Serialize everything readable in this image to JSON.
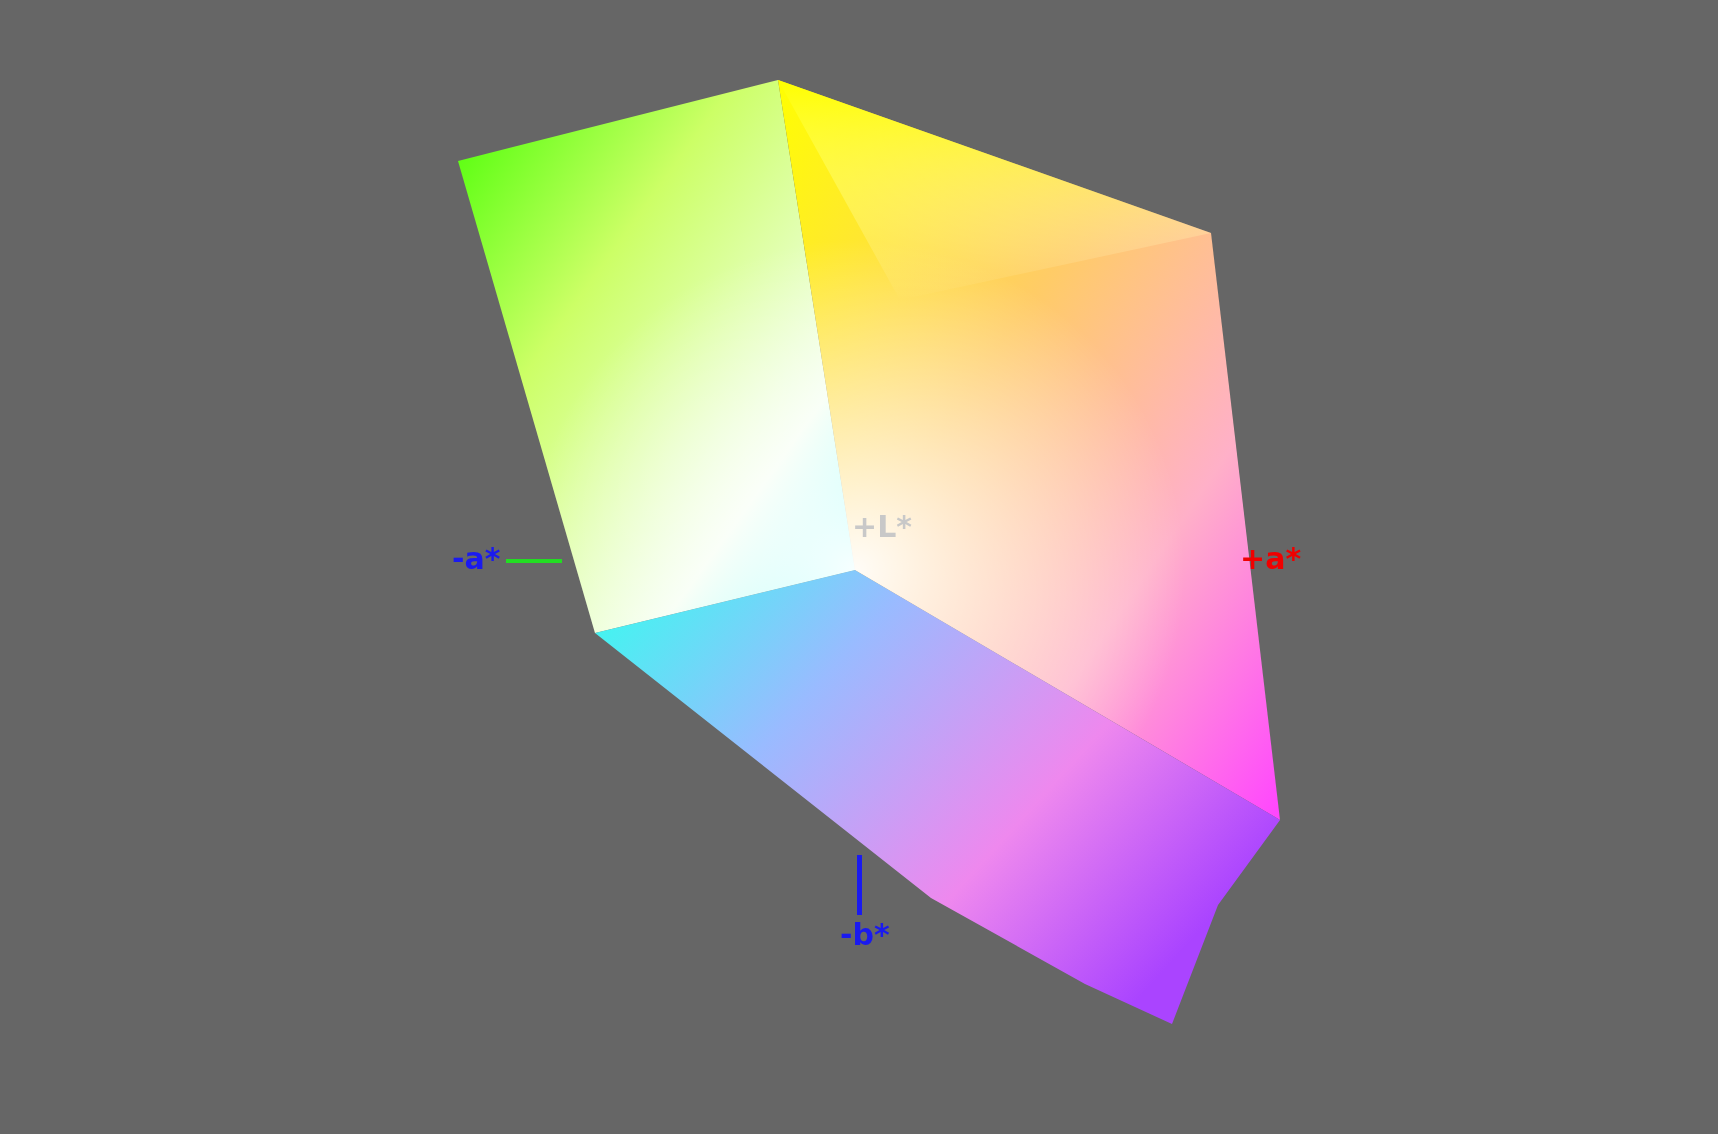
{
  "axis_labels": [
    {
      "text": "-a*",
      "color": "#1a1af0"
    },
    {
      "text": "+L*",
      "color": "#c8c8c8"
    },
    {
      "text": "+a*",
      "color": "#f00000"
    },
    {
      "text": "-b*",
      "color": "#1a1af0"
    }
  ]
}
